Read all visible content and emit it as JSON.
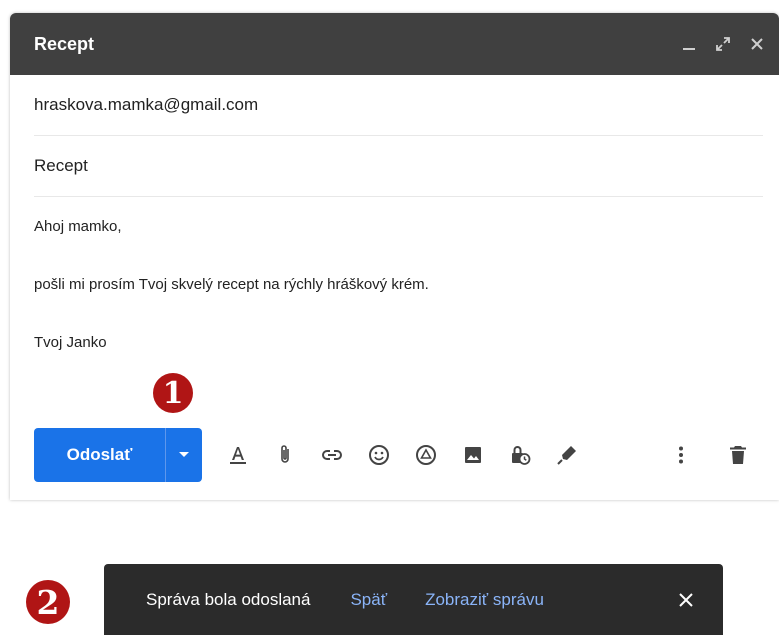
{
  "compose": {
    "title": "Recept",
    "to": "hraskova.mamka@gmail.com",
    "subject": "Recept",
    "body": {
      "greeting": "Ahoj mamko,",
      "message": "pošli mi prosím Tvoj skvelý recept na rýchly hráškový krém.",
      "signature": "Tvoj Janko"
    },
    "window_controls": [
      "minimize-icon",
      "expand-icon",
      "close-icon"
    ],
    "toolbar": {
      "send_label": "Odoslať",
      "icons": [
        "format-text-icon",
        "attachment-icon",
        "link-icon",
        "emoji-icon",
        "drive-icon",
        "photo-icon",
        "confidential-lock-icon",
        "signature-pen-icon",
        "more-options-icon",
        "delete-icon"
      ]
    }
  },
  "markers": {
    "one": "1",
    "two": "2"
  },
  "snackbar": {
    "message": "Správa bola odoslaná",
    "undo_label": "Späť",
    "view_label": "Zobraziť správu"
  },
  "colors": {
    "titlebar": "#404040",
    "send_button": "#1a73e8",
    "snackbar": "#2b2b2b",
    "snackbar_link": "#8ab4f8",
    "marker": "#b01515"
  }
}
